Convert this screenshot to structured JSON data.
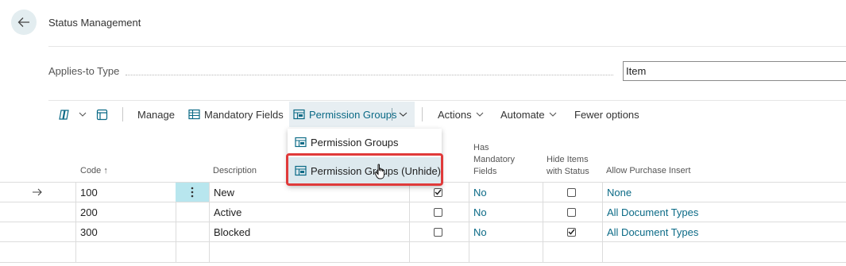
{
  "header": {
    "title": "Status Management"
  },
  "field": {
    "label": "Applies-to Type",
    "value": "Item"
  },
  "actionbar": {
    "manage": "Manage",
    "mandatory_fields": "Mandatory Fields",
    "permission_groups": "Permission Groups",
    "actions": "Actions",
    "automate": "Automate",
    "fewer_options": "Fewer options"
  },
  "dropdown": {
    "items": [
      "Permission Groups",
      "Permission Groups (Unhide)"
    ]
  },
  "columns": {
    "code": "Code",
    "code_sort": "↑",
    "description": "Description",
    "has_mandatory": [
      "Has",
      "Mandatory",
      "Fields"
    ],
    "hide_items": [
      "Hide Items",
      "with Status"
    ],
    "allow_purchase": "Allow Purchase Insert"
  },
  "rows": [
    {
      "code": "100",
      "description": "New",
      "mandatory_checked": true,
      "has_mandatory_fields": "No",
      "hide_items_checked": false,
      "allow_purchase_insert": "None"
    },
    {
      "code": "200",
      "description": "Active",
      "mandatory_checked": false,
      "has_mandatory_fields": "No",
      "hide_items_checked": false,
      "allow_purchase_insert": "All Document Types"
    },
    {
      "code": "300",
      "description": "Blocked",
      "mandatory_checked": false,
      "has_mandatory_fields": "No",
      "hide_items_checked": true,
      "allow_purchase_insert": "All Document Types"
    }
  ],
  "colors": {
    "accent": "#0b6a86",
    "highlight_red": "#e03a3a",
    "selected_bg": "#b8e6ee"
  }
}
